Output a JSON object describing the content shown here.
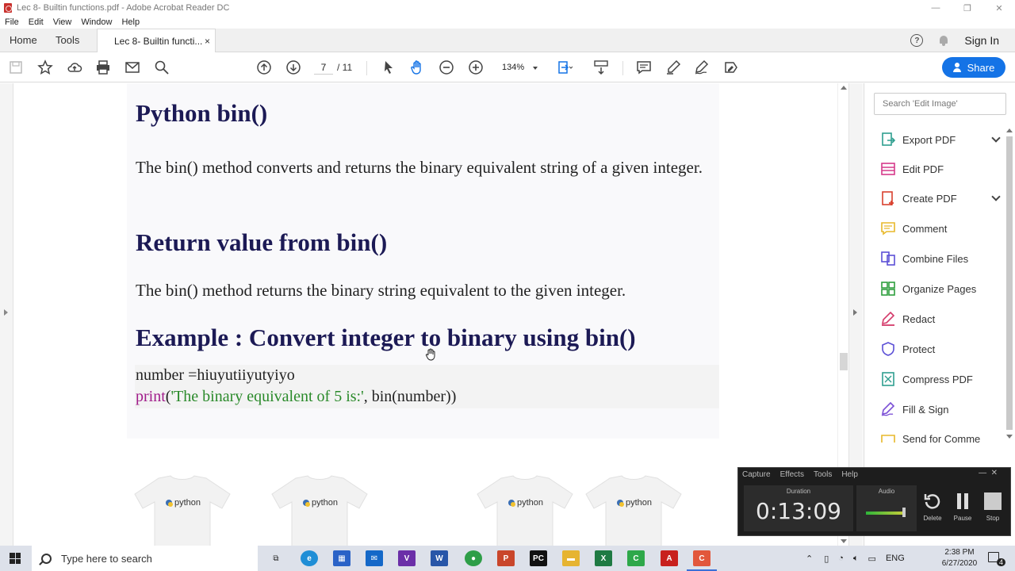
{
  "window": {
    "title": "Lec 8- Builtin functions.pdf - Adobe Acrobat Reader DC",
    "controls": [
      "—",
      "❐",
      "✕"
    ]
  },
  "menu": [
    "File",
    "Edit",
    "View",
    "Window",
    "Help"
  ],
  "tabs": {
    "home": "Home",
    "tools": "Tools",
    "document": "Lec 8- Builtin functi...",
    "close": "×",
    "help_glyph": "?",
    "sign_in": "Sign In"
  },
  "toolbar": {
    "current_page": "7",
    "total_pages": "/ 11",
    "zoom": "134%",
    "share": "Share"
  },
  "document": {
    "heading1": "Python bin()",
    "para1": "The bin() method converts and returns the binary equivalent string of a given integer.",
    "heading2": "Return value from bin()",
    "para2": "The bin() method returns the binary string equivalent to the given integer.",
    "heading3": "Example : Convert integer to binary using bin()",
    "code_line1": "number =hiuyutiiyutyiyo",
    "code_kw": "print",
    "code_paren_open": "(",
    "code_str": "'The binary equivalent of 5 is:'",
    "code_rest": ", bin(number))",
    "shirt_text": "python"
  },
  "right_pane": {
    "search_placeholder": "Search 'Edit Image'",
    "tools": [
      {
        "label": "Export PDF",
        "color": "#2f9e8f"
      },
      {
        "label": "Edit PDF",
        "color": "#d53a8a"
      },
      {
        "label": "Create PDF",
        "color": "#d9412f"
      },
      {
        "label": "Comment",
        "color": "#e8b82a"
      },
      {
        "label": "Combine Files",
        "color": "#5b4fd6"
      },
      {
        "label": "Organize Pages",
        "color": "#2e9e3d"
      },
      {
        "label": "Redact",
        "color": "#d43a6a"
      },
      {
        "label": "Protect",
        "color": "#5b4fd6"
      },
      {
        "label": "Compress PDF",
        "color": "#2f9e8f"
      },
      {
        "label": "Fill & Sign",
        "color": "#7b4fd6"
      },
      {
        "label": "Send for Comme",
        "color": "#e8b82a"
      }
    ]
  },
  "recorder": {
    "menu": [
      "Capture",
      "Effects",
      "Tools",
      "Help"
    ],
    "duration_label": "Duration",
    "duration": "0:13:09",
    "audio_label": "Audio",
    "delete": "Delete",
    "pause": "Pause",
    "stop": "Stop"
  },
  "taskbar": {
    "search_placeholder": "Type here to search",
    "language": "ENG",
    "time": "2:38 PM",
    "date": "6/27/2020",
    "notification_count": "4"
  },
  "colors": {
    "accent": "#1473e6",
    "heading": "#1c1a55",
    "keyword": "#a01b8a",
    "string": "#2a8a2a"
  }
}
